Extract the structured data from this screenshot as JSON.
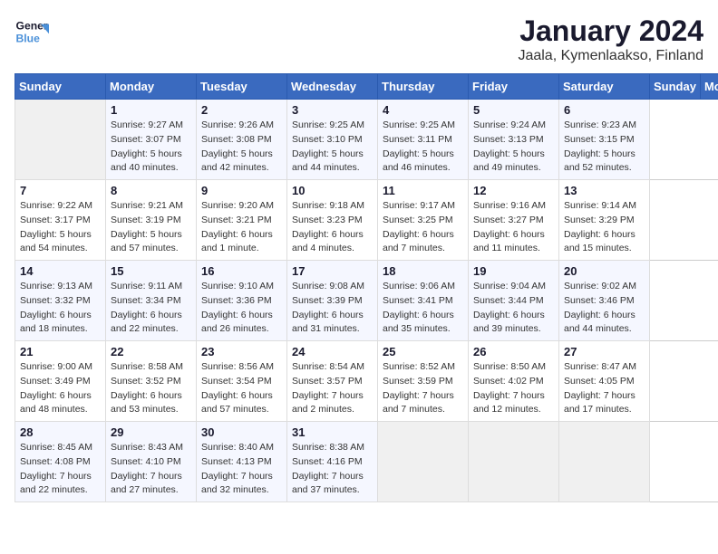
{
  "header": {
    "logo_line1": "General",
    "logo_line2": "Blue",
    "month": "January 2024",
    "location": "Jaala, Kymenlaakso, Finland"
  },
  "columns": [
    "Sunday",
    "Monday",
    "Tuesday",
    "Wednesday",
    "Thursday",
    "Friday",
    "Saturday"
  ],
  "weeks": [
    [
      {
        "day": "",
        "sunrise": "",
        "sunset": "",
        "daylight": ""
      },
      {
        "day": "1",
        "sunrise": "Sunrise: 9:27 AM",
        "sunset": "Sunset: 3:07 PM",
        "daylight": "Daylight: 5 hours and 40 minutes."
      },
      {
        "day": "2",
        "sunrise": "Sunrise: 9:26 AM",
        "sunset": "Sunset: 3:08 PM",
        "daylight": "Daylight: 5 hours and 42 minutes."
      },
      {
        "day": "3",
        "sunrise": "Sunrise: 9:25 AM",
        "sunset": "Sunset: 3:10 PM",
        "daylight": "Daylight: 5 hours and 44 minutes."
      },
      {
        "day": "4",
        "sunrise": "Sunrise: 9:25 AM",
        "sunset": "Sunset: 3:11 PM",
        "daylight": "Daylight: 5 hours and 46 minutes."
      },
      {
        "day": "5",
        "sunrise": "Sunrise: 9:24 AM",
        "sunset": "Sunset: 3:13 PM",
        "daylight": "Daylight: 5 hours and 49 minutes."
      },
      {
        "day": "6",
        "sunrise": "Sunrise: 9:23 AM",
        "sunset": "Sunset: 3:15 PM",
        "daylight": "Daylight: 5 hours and 52 minutes."
      }
    ],
    [
      {
        "day": "7",
        "sunrise": "Sunrise: 9:22 AM",
        "sunset": "Sunset: 3:17 PM",
        "daylight": "Daylight: 5 hours and 54 minutes."
      },
      {
        "day": "8",
        "sunrise": "Sunrise: 9:21 AM",
        "sunset": "Sunset: 3:19 PM",
        "daylight": "Daylight: 5 hours and 57 minutes."
      },
      {
        "day": "9",
        "sunrise": "Sunrise: 9:20 AM",
        "sunset": "Sunset: 3:21 PM",
        "daylight": "Daylight: 6 hours and 1 minute."
      },
      {
        "day": "10",
        "sunrise": "Sunrise: 9:18 AM",
        "sunset": "Sunset: 3:23 PM",
        "daylight": "Daylight: 6 hours and 4 minutes."
      },
      {
        "day": "11",
        "sunrise": "Sunrise: 9:17 AM",
        "sunset": "Sunset: 3:25 PM",
        "daylight": "Daylight: 6 hours and 7 minutes."
      },
      {
        "day": "12",
        "sunrise": "Sunrise: 9:16 AM",
        "sunset": "Sunset: 3:27 PM",
        "daylight": "Daylight: 6 hours and 11 minutes."
      },
      {
        "day": "13",
        "sunrise": "Sunrise: 9:14 AM",
        "sunset": "Sunset: 3:29 PM",
        "daylight": "Daylight: 6 hours and 15 minutes."
      }
    ],
    [
      {
        "day": "14",
        "sunrise": "Sunrise: 9:13 AM",
        "sunset": "Sunset: 3:32 PM",
        "daylight": "Daylight: 6 hours and 18 minutes."
      },
      {
        "day": "15",
        "sunrise": "Sunrise: 9:11 AM",
        "sunset": "Sunset: 3:34 PM",
        "daylight": "Daylight: 6 hours and 22 minutes."
      },
      {
        "day": "16",
        "sunrise": "Sunrise: 9:10 AM",
        "sunset": "Sunset: 3:36 PM",
        "daylight": "Daylight: 6 hours and 26 minutes."
      },
      {
        "day": "17",
        "sunrise": "Sunrise: 9:08 AM",
        "sunset": "Sunset: 3:39 PM",
        "daylight": "Daylight: 6 hours and 31 minutes."
      },
      {
        "day": "18",
        "sunrise": "Sunrise: 9:06 AM",
        "sunset": "Sunset: 3:41 PM",
        "daylight": "Daylight: 6 hours and 35 minutes."
      },
      {
        "day": "19",
        "sunrise": "Sunrise: 9:04 AM",
        "sunset": "Sunset: 3:44 PM",
        "daylight": "Daylight: 6 hours and 39 minutes."
      },
      {
        "day": "20",
        "sunrise": "Sunrise: 9:02 AM",
        "sunset": "Sunset: 3:46 PM",
        "daylight": "Daylight: 6 hours and 44 minutes."
      }
    ],
    [
      {
        "day": "21",
        "sunrise": "Sunrise: 9:00 AM",
        "sunset": "Sunset: 3:49 PM",
        "daylight": "Daylight: 6 hours and 48 minutes."
      },
      {
        "day": "22",
        "sunrise": "Sunrise: 8:58 AM",
        "sunset": "Sunset: 3:52 PM",
        "daylight": "Daylight: 6 hours and 53 minutes."
      },
      {
        "day": "23",
        "sunrise": "Sunrise: 8:56 AM",
        "sunset": "Sunset: 3:54 PM",
        "daylight": "Daylight: 6 hours and 57 minutes."
      },
      {
        "day": "24",
        "sunrise": "Sunrise: 8:54 AM",
        "sunset": "Sunset: 3:57 PM",
        "daylight": "Daylight: 7 hours and 2 minutes."
      },
      {
        "day": "25",
        "sunrise": "Sunrise: 8:52 AM",
        "sunset": "Sunset: 3:59 PM",
        "daylight": "Daylight: 7 hours and 7 minutes."
      },
      {
        "day": "26",
        "sunrise": "Sunrise: 8:50 AM",
        "sunset": "Sunset: 4:02 PM",
        "daylight": "Daylight: 7 hours and 12 minutes."
      },
      {
        "day": "27",
        "sunrise": "Sunrise: 8:47 AM",
        "sunset": "Sunset: 4:05 PM",
        "daylight": "Daylight: 7 hours and 17 minutes."
      }
    ],
    [
      {
        "day": "28",
        "sunrise": "Sunrise: 8:45 AM",
        "sunset": "Sunset: 4:08 PM",
        "daylight": "Daylight: 7 hours and 22 minutes."
      },
      {
        "day": "29",
        "sunrise": "Sunrise: 8:43 AM",
        "sunset": "Sunset: 4:10 PM",
        "daylight": "Daylight: 7 hours and 27 minutes."
      },
      {
        "day": "30",
        "sunrise": "Sunrise: 8:40 AM",
        "sunset": "Sunset: 4:13 PM",
        "daylight": "Daylight: 7 hours and 32 minutes."
      },
      {
        "day": "31",
        "sunrise": "Sunrise: 8:38 AM",
        "sunset": "Sunset: 4:16 PM",
        "daylight": "Daylight: 7 hours and 37 minutes."
      },
      {
        "day": "",
        "sunrise": "",
        "sunset": "",
        "daylight": ""
      },
      {
        "day": "",
        "sunrise": "",
        "sunset": "",
        "daylight": ""
      },
      {
        "day": "",
        "sunrise": "",
        "sunset": "",
        "daylight": ""
      }
    ]
  ]
}
